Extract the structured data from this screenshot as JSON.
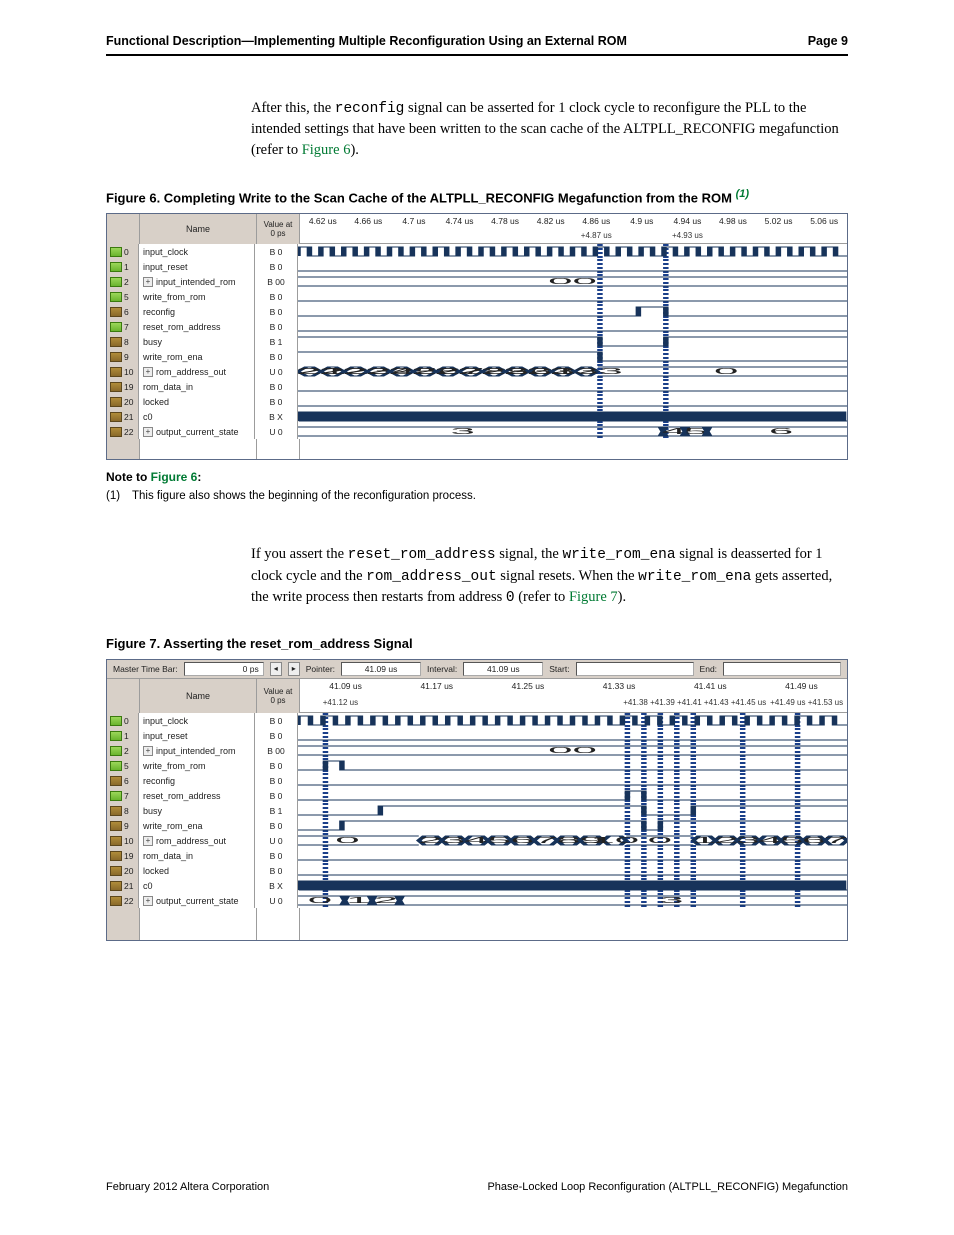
{
  "header": {
    "left": "Functional Description—Implementing Multiple Reconfiguration Using an External ROM",
    "right": "Page 9"
  },
  "para1_pre": "After this, the ",
  "para1_sig": "reconfig",
  "para1_post1": " signal can be asserted for 1 clock cycle to reconfigure the PLL to the intended settings that have been written to the scan cache of the ALTPLL_RECONFIG megafunction (refer to ",
  "para1_link": "Figure 6",
  "para1_post2": ").",
  "fig6_caption": "Figure 6.  Completing Write to the Scan Cache of the ALTPLL_RECONFIG Megafunction from the ROM ",
  "fig6_ref": "(1)",
  "wf_common_headers": {
    "name": "Name",
    "value_top": "Value at",
    "value_bot": "0 ps"
  },
  "fig6_times_top": [
    "4.62 us",
    "4.66 us",
    "4.7 us",
    "4.74 us",
    "4.78 us",
    "4.82 us",
    "4.86 us",
    "4.9 us",
    "4.94 us",
    "4.98 us",
    "5.02 us",
    "5.06 us"
  ],
  "fig6_times_sub": [
    "",
    "",
    "",
    "",
    "",
    "",
    "+4.87 us",
    "",
    "+4.93 us",
    "",
    "",
    ""
  ],
  "fig6_rows": [
    {
      "idx": "0",
      "type": "in",
      "plus": false,
      "name": "input_clock",
      "val": "B 0"
    },
    {
      "idx": "1",
      "type": "in",
      "plus": false,
      "name": "input_reset",
      "val": "B 0"
    },
    {
      "idx": "2",
      "type": "in",
      "plus": true,
      "name": "input_intended_rom",
      "val": "B 00"
    },
    {
      "idx": "5",
      "type": "in",
      "plus": false,
      "name": "write_from_rom",
      "val": "B 0"
    },
    {
      "idx": "6",
      "type": "out",
      "plus": false,
      "name": "reconfig",
      "val": "B 0"
    },
    {
      "idx": "7",
      "type": "in",
      "plus": false,
      "name": "reset_rom_address",
      "val": "B 0"
    },
    {
      "idx": "8",
      "type": "out",
      "plus": false,
      "name": "busy",
      "val": "B 1"
    },
    {
      "idx": "9",
      "type": "out",
      "plus": false,
      "name": "write_rom_ena",
      "val": "B 0"
    },
    {
      "idx": "10",
      "type": "out",
      "plus": true,
      "name": "rom_address_out",
      "val": "U 0"
    },
    {
      "idx": "19",
      "type": "out",
      "plus": false,
      "name": "rom_data_in",
      "val": "B 0"
    },
    {
      "idx": "20",
      "type": "out",
      "plus": false,
      "name": "locked",
      "val": "B 0"
    },
    {
      "idx": "21",
      "type": "out",
      "plus": false,
      "name": "c0",
      "val": "B X"
    },
    {
      "idx": "22",
      "type": "out",
      "plus": true,
      "name": "output_current_state",
      "val": "U 0"
    }
  ],
  "fig6_bus_rom": [
    "221",
    "222",
    "223",
    "224",
    "225",
    "226",
    "227",
    "228",
    "229",
    "230",
    "231",
    "232",
    "233"
  ],
  "fig6_bus_rom_after": "0",
  "fig6_bus_intended": "00",
  "fig6_bus_state": [
    "3",
    "4",
    "5",
    "6"
  ],
  "note6_heading_pre": "Note to ",
  "note6_heading_link": "Figure 6",
  "note6_heading_post": ":",
  "note6_num": "(1)",
  "note6_text": "This figure also shows the beginning of the reconfiguration process.",
  "para2_a": "If you assert the ",
  "para2_sig1": "reset_rom_address",
  "para2_b": " signal, the ",
  "para2_sig2": "write_rom_ena",
  "para2_c": " signal is deasserted for 1 clock cycle and the ",
  "para2_sig3": "rom_address_out",
  "para2_d": " signal resets. When the ",
  "para2_sig4": "write_rom_ena",
  "para2_e": " gets asserted, the write process then restarts from address ",
  "para2_addr": "0",
  "para2_f": " (refer to ",
  "para2_link": "Figure 7",
  "para2_g": ").",
  "fig7_caption": "Figure 7.  Asserting the reset_rom_address Signal",
  "topbar": {
    "master": "Master Time Bar:",
    "master_v": "0 ps",
    "pointer": "Pointer:",
    "pointer_v": "41.09 us",
    "interval": "Interval:",
    "interval_v": "41.09 us",
    "start": "Start:",
    "end": "End:"
  },
  "fig7_times_top": [
    "41.09 us",
    "41.17 us",
    "41.25 us",
    "41.33 us",
    "41.41 us",
    "41.49 us"
  ],
  "fig7_times_sub": [
    "+41.12 us",
    "",
    "",
    "",
    "+41.38 +41.39 +41.41 +41.43 +41.45 us",
    "+41.49 us   +41.53 us"
  ],
  "fig7_rows": [
    {
      "idx": "0",
      "type": "in",
      "plus": false,
      "name": "input_clock",
      "val": "B 0"
    },
    {
      "idx": "1",
      "type": "in",
      "plus": false,
      "name": "input_reset",
      "val": "B 0"
    },
    {
      "idx": "2",
      "type": "in",
      "plus": true,
      "name": "input_intended_rom",
      "val": "B 00"
    },
    {
      "idx": "5",
      "type": "in",
      "plus": false,
      "name": "write_from_rom",
      "val": "B 0"
    },
    {
      "idx": "6",
      "type": "out",
      "plus": false,
      "name": "reconfig",
      "val": "B 0"
    },
    {
      "idx": "7",
      "type": "in",
      "plus": false,
      "name": "reset_rom_address",
      "val": "B 0"
    },
    {
      "idx": "8",
      "type": "out",
      "plus": false,
      "name": "busy",
      "val": "B 1"
    },
    {
      "idx": "9",
      "type": "out",
      "plus": false,
      "name": "write_rom_ena",
      "val": "B 0"
    },
    {
      "idx": "10",
      "type": "out",
      "plus": true,
      "name": "rom_address_out",
      "val": "U 0"
    },
    {
      "idx": "19",
      "type": "out",
      "plus": false,
      "name": "rom_data_in",
      "val": "B 0"
    },
    {
      "idx": "20",
      "type": "out",
      "plus": false,
      "name": "locked",
      "val": "B 0"
    },
    {
      "idx": "21",
      "type": "out",
      "plus": false,
      "name": "c0",
      "val": "B X"
    },
    {
      "idx": "22",
      "type": "out",
      "plus": true,
      "name": "output_current_state",
      "val": "U 0"
    }
  ],
  "fig7_bus_intended": "00",
  "fig7_bus_rom_pre": "0",
  "fig7_bus_rom_seq1": [
    "2",
    "3",
    "4",
    "5",
    "6",
    "7",
    "8",
    "9",
    "10"
  ],
  "fig7_bus_rom_mid": "0",
  "fig7_bus_rom_seq2": [
    "1",
    "2",
    "3",
    "4",
    "5",
    "6",
    "7"
  ],
  "fig7_bus_state": [
    "0",
    "1",
    "2",
    "",
    "3"
  ],
  "footer": {
    "left": "February 2012   Altera Corporation",
    "right": "Phase-Locked Loop Reconfiguration (ALTPLL_RECONFIG) Megafunction"
  }
}
